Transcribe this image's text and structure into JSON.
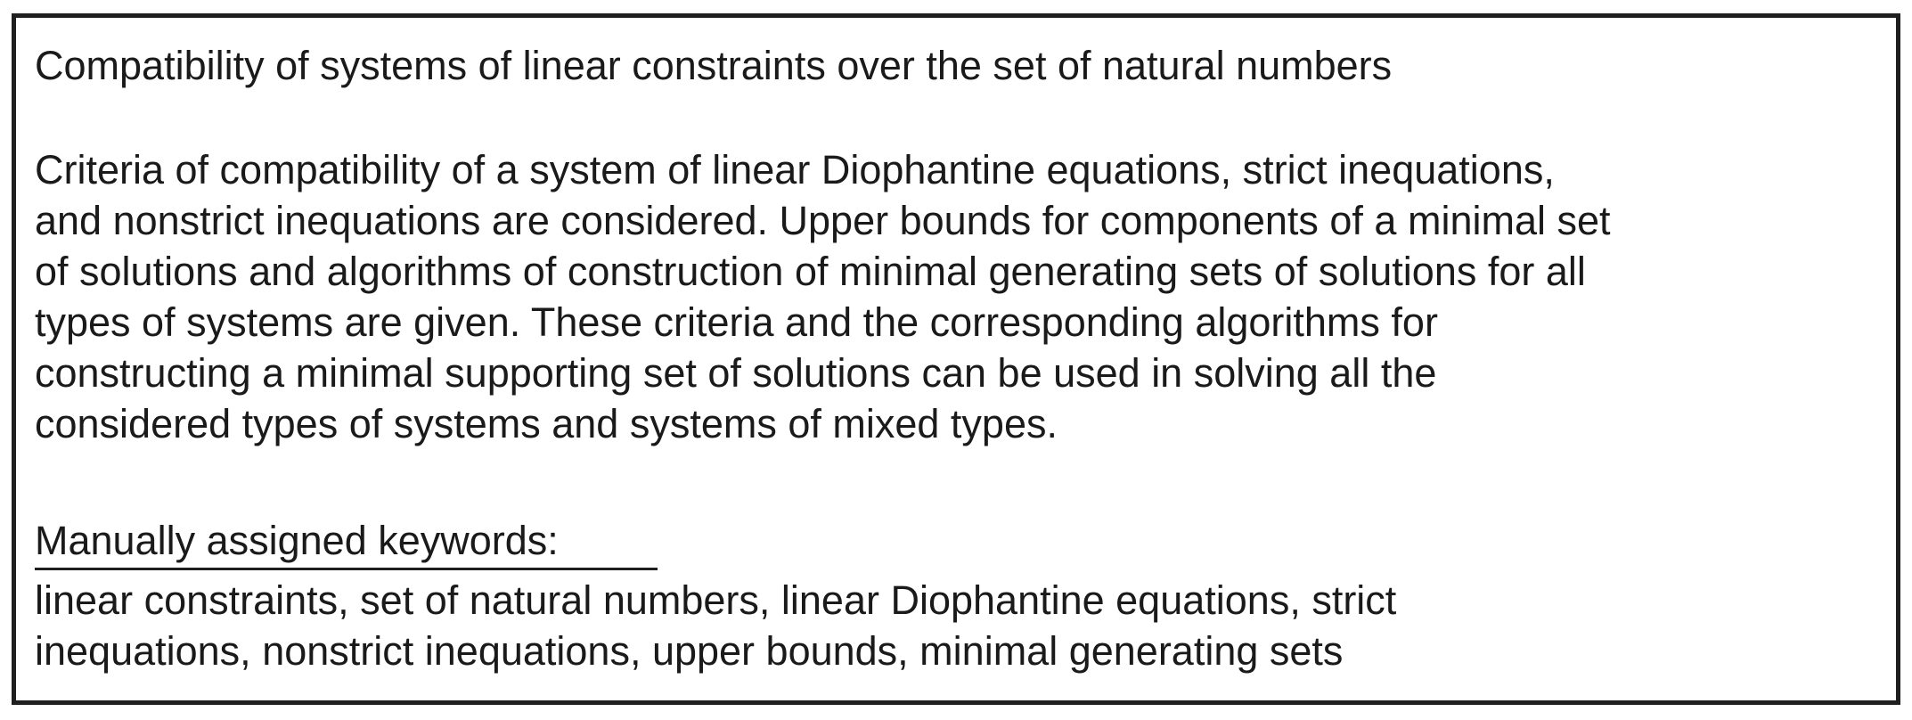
{
  "title": "Compatibility of systems of linear constraints over the set of natural numbers",
  "abstract_lines": [
    "Criteria of compatibility of a system of linear Diophantine equations, strict inequations,",
    "and nonstrict inequations are considered. Upper bounds for components of a minimal set",
    "of solutions and algorithms of construction of minimal generating sets of solutions for all",
    "types of systems are given. These criteria and the corresponding algorithms for",
    "constructing a minimal supporting set of solutions can be used in solving all the",
    "considered types of systems and systems of mixed types."
  ],
  "keywords_label": "Manually assigned keywords:",
  "keywords_lines": [
    "linear constraints, set of natural numbers, linear Diophantine equations, strict",
    "inequations, nonstrict inequations, upper bounds, minimal generating sets"
  ]
}
